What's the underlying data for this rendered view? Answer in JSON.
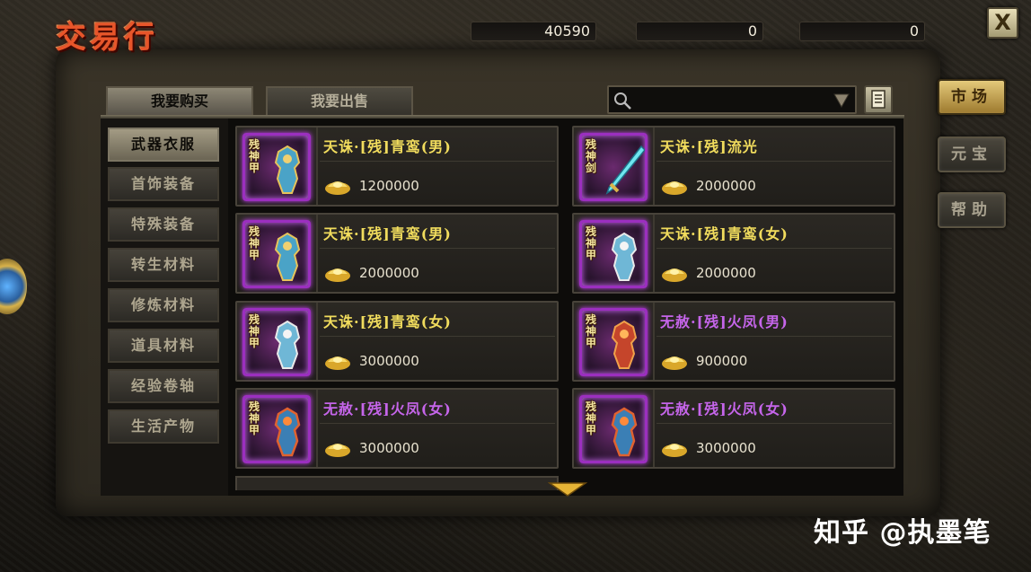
{
  "title": "交易行",
  "currency": [
    {
      "icon": "gold-ingot-plus-icon",
      "value": "40590"
    },
    {
      "icon": "gold-coin-plus-icon",
      "value": "0"
    },
    {
      "icon": "green-coin-plus-icon",
      "value": "0"
    }
  ],
  "close_label": "X",
  "tabs": [
    {
      "label": "我要购买",
      "active": true
    },
    {
      "label": "我要出售",
      "active": false
    }
  ],
  "search": {
    "placeholder": "",
    "value": ""
  },
  "side_buttons": [
    {
      "label": "市场",
      "active": true
    },
    {
      "label": "元宝",
      "active": false
    },
    {
      "label": "帮助",
      "active": false
    }
  ],
  "categories": [
    {
      "label": "武器衣服",
      "active": true
    },
    {
      "label": "首饰装备",
      "active": false
    },
    {
      "label": "特殊装备",
      "active": false
    },
    {
      "label": "转生材料",
      "active": false
    },
    {
      "label": "修炼材料",
      "active": false
    },
    {
      "label": "道具材料",
      "active": false
    },
    {
      "label": "经验卷轴",
      "active": false
    },
    {
      "label": "生活产物",
      "active": false
    }
  ],
  "items": [
    {
      "name": "天诛·[残]青鸾(男)",
      "price": "1200000",
      "tag": "残神甲",
      "color": "yellow",
      "art": "armor-blue-gold"
    },
    {
      "name": "天诛·[残]流光",
      "price": "2000000",
      "tag": "残神剑",
      "color": "yellow",
      "art": "sword-cyan"
    },
    {
      "name": "天诛·[残]青鸾(男)",
      "price": "2000000",
      "tag": "残神甲",
      "color": "yellow",
      "art": "armor-blue-gold"
    },
    {
      "name": "天诛·[残]青鸾(女)",
      "price": "2000000",
      "tag": "残神甲",
      "color": "yellow",
      "art": "armor-blue-white"
    },
    {
      "name": "天诛·[残]青鸾(女)",
      "price": "3000000",
      "tag": "残神甲",
      "color": "yellow",
      "art": "armor-blue-white"
    },
    {
      "name": "无赦·[残]火凤(男)",
      "price": "900000",
      "tag": "残神甲",
      "color": "purple",
      "art": "armor-red"
    },
    {
      "name": "无赦·[残]火凤(女)",
      "price": "3000000",
      "tag": "残神甲",
      "color": "purple",
      "art": "armor-red-blue"
    },
    {
      "name": "无赦·[残]火凤(女)",
      "price": "3000000",
      "tag": "残神甲",
      "color": "purple",
      "art": "armor-red-blue"
    }
  ],
  "watermark": "知乎 @执墨笔",
  "colors": {
    "name_yellow": "#f1dc5d",
    "name_purple": "#c565ea",
    "item_frame": "#9b2fbf",
    "active_side": "#e4c979"
  }
}
